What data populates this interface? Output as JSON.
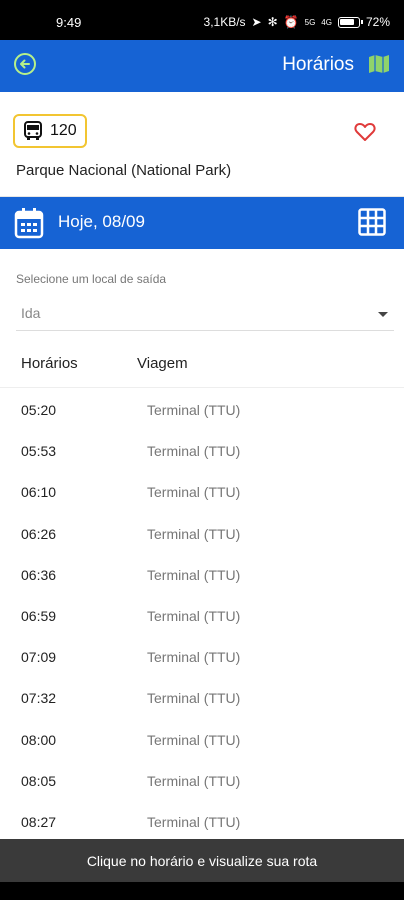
{
  "status": {
    "time": "9:49",
    "network": "3,1KB/s",
    "signal_a": "5G",
    "signal_b": "4G",
    "battery": "72"
  },
  "app_bar": {
    "title": "Horários",
    "back_icon": "back-circle-icon",
    "map_icon": "map-icon"
  },
  "route": {
    "number": "120",
    "name": "Parque Nacional (National Park)",
    "bus_icon": "bus-icon",
    "favorite_icon": "heart-outline-icon",
    "accent_color": "#f2c531",
    "favorite_color": "#e03a3a"
  },
  "date_bar": {
    "label": "Hoje, 08/09",
    "calendar_icon": "calendar-icon",
    "grid_icon": "grid-icon"
  },
  "departure": {
    "hint": "Selecione um local de saída",
    "selected": "Ida"
  },
  "table": {
    "col_time": "Horários",
    "col_trip": "Viagem",
    "rows": [
      {
        "time": "05:20",
        "trip": "Terminal (TTU)"
      },
      {
        "time": "05:53",
        "trip": "Terminal (TTU)"
      },
      {
        "time": "06:10",
        "trip": "Terminal (TTU)"
      },
      {
        "time": "06:26",
        "trip": "Terminal (TTU)"
      },
      {
        "time": "06:36",
        "trip": "Terminal (TTU)"
      },
      {
        "time": "06:59",
        "trip": "Terminal (TTU)"
      },
      {
        "time": "07:09",
        "trip": "Terminal (TTU)"
      },
      {
        "time": "07:32",
        "trip": "Terminal (TTU)"
      },
      {
        "time": "08:00",
        "trip": "Terminal (TTU)"
      },
      {
        "time": "08:05",
        "trip": "Terminal (TTU)"
      },
      {
        "time": "08:27",
        "trip": "Terminal (TTU)"
      }
    ]
  },
  "footer": {
    "hint": "Clique no horário e visualize sua rota"
  },
  "colors": {
    "primary": "#1663d4",
    "back_accent": "#b6f08a",
    "map_accent": "#8fd36b"
  }
}
